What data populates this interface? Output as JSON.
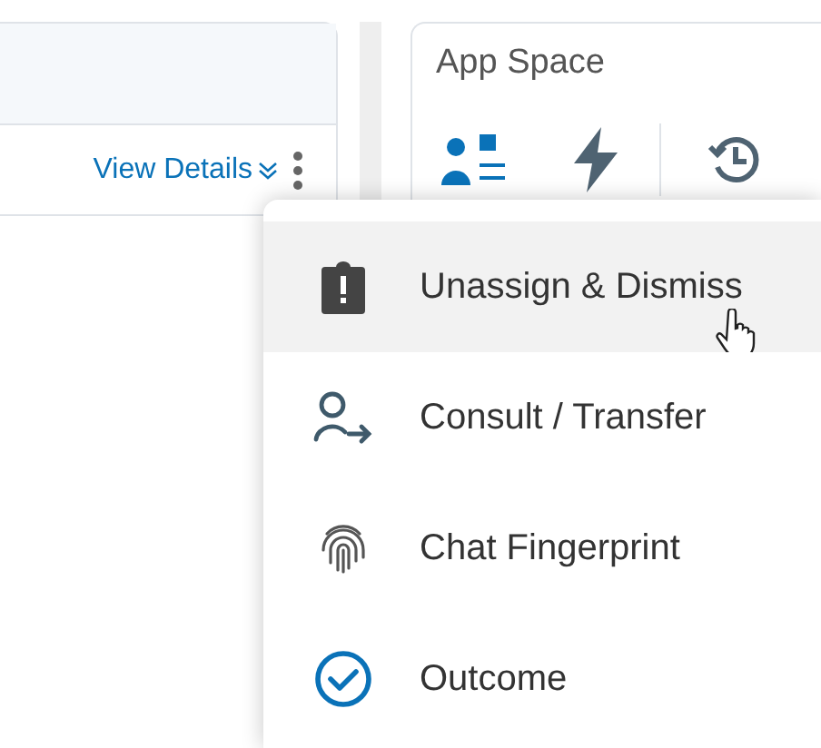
{
  "details_link": {
    "label": "View Details"
  },
  "app_space": {
    "title": "App Space",
    "tabs": [
      {
        "kind": "contact",
        "selected": true
      },
      {
        "kind": "bolt",
        "selected": false
      },
      {
        "kind": "history",
        "selected": false
      }
    ]
  },
  "menu": {
    "items": [
      {
        "kind": "unassign",
        "label": "Unassign & Dismiss",
        "hovered": true
      },
      {
        "kind": "transfer",
        "label": "Consult / Transfer",
        "hovered": false
      },
      {
        "kind": "fingerprint",
        "label": "Chat Fingerprint",
        "hovered": false
      },
      {
        "kind": "outcome",
        "label": "Outcome",
        "hovered": false
      }
    ]
  }
}
